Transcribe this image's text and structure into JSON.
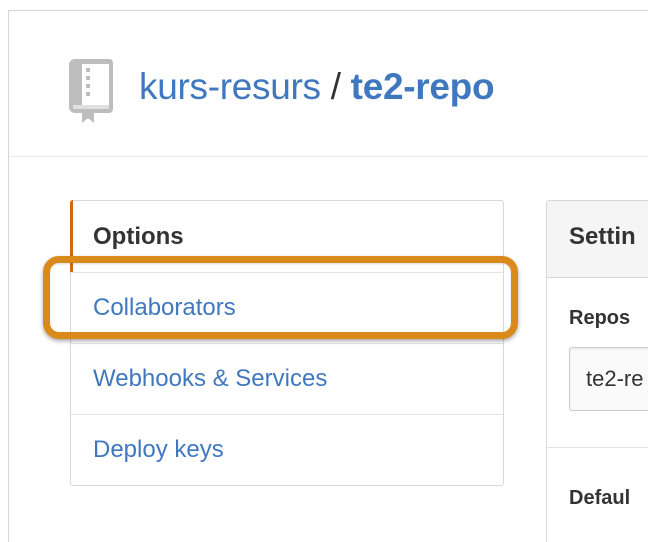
{
  "repo": {
    "owner": "kurs-resurs",
    "separator": " / ",
    "name": "te2-repo",
    "icon": "repo-book-icon"
  },
  "menu": {
    "items": [
      {
        "label": "Options",
        "selected": true
      },
      {
        "label": "Collaborators",
        "selected": false,
        "highlighted": true
      },
      {
        "label": "Webhooks & Services",
        "selected": false
      },
      {
        "label": "Deploy keys",
        "selected": false
      }
    ]
  },
  "settings": {
    "title": "Settin",
    "repo_label": "Repos",
    "repo_value": "te2-re",
    "default_label": "Defaul"
  },
  "colors": {
    "link": "#4078c0",
    "selected_accent": "#d26911",
    "highlight_outline": "#d98a1a"
  }
}
